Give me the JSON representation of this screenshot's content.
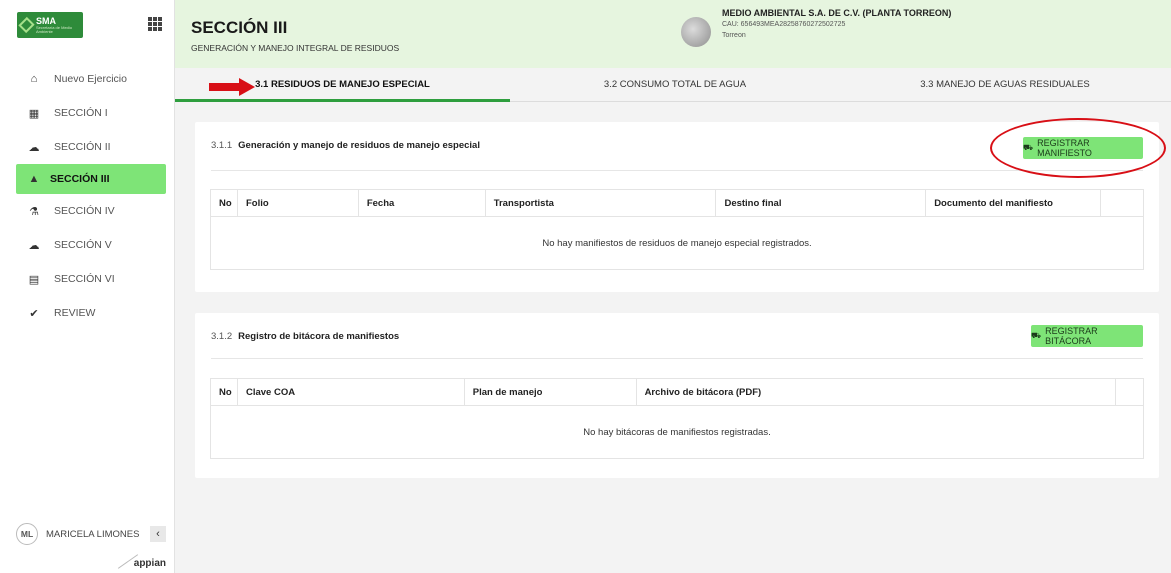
{
  "sidebar": {
    "logo_text": "SMA",
    "logo_subtext": "Secretaría de Medio Ambiente",
    "items": [
      {
        "label": "Nuevo Ejercicio",
        "icon": "home-icon",
        "glyph": "⌂"
      },
      {
        "label": "SECCIÓN I",
        "icon": "building-icon",
        "glyph": "▦"
      },
      {
        "label": "SECCIÓN II",
        "icon": "cloud-rain-icon",
        "glyph": "☁"
      },
      {
        "label": "SECCIÓN III",
        "icon": "warning-icon",
        "glyph": "▲",
        "active": true
      },
      {
        "label": "SECCIÓN IV",
        "icon": "flask-icon",
        "glyph": "⚗"
      },
      {
        "label": "SECCIÓN V",
        "icon": "cloud-icon",
        "glyph": "☁"
      },
      {
        "label": "SECCIÓN VI",
        "icon": "document-icon",
        "glyph": "▤"
      },
      {
        "label": "REVIEW",
        "icon": "check-circle-icon",
        "glyph": "✔"
      }
    ],
    "user": {
      "initials": "ML",
      "name": "MARICELA LIMONES",
      "collapse_glyph": "‹"
    },
    "brand": "appian"
  },
  "header": {
    "title": "SECCIÓN III",
    "subtitle": "GENERACIÓN Y MANEJO INTEGRAL DE RESIDUOS",
    "company": {
      "name": "MEDIO AMBIENTAL S.A. DE C.V. (PLANTA TORREON)",
      "cau": "CAU: 656493MEA28258760272502725",
      "city": "Torreon"
    }
  },
  "tabs": [
    {
      "label": "3.1 RESIDUOS DE MANEJO ESPECIAL",
      "active": true
    },
    {
      "label": "3.2 CONSUMO TOTAL DE AGUA"
    },
    {
      "label": "3.3 MANEJO DE AGUAS RESIDUALES"
    }
  ],
  "section1": {
    "number": "3.1.1",
    "title": "Generación y manejo de residuos de manejo especial",
    "button_label": "REGISTRAR MANIFIESTO",
    "columns": [
      "No",
      "Folio",
      "Fecha",
      "Transportista",
      "Destino final",
      "Documento del manifiesto",
      ""
    ],
    "empty_message": "No hay manifiestos de residuos de manejo especial registrados."
  },
  "section2": {
    "number": "3.1.2",
    "title": "Registro de bitácora de manifiestos",
    "button_label": "REGISTRAR BITÁCORA",
    "columns": [
      "No",
      "Clave COA",
      "Plan de manejo",
      "Archivo de bitácora (PDF)",
      ""
    ],
    "empty_message": "No hay bitácoras de manifiestos registradas."
  },
  "colors": {
    "accent_green": "#7ee477",
    "header_bg": "#e6f5df",
    "tab_underline": "#2e9e3e",
    "annotation_red": "#d80f16"
  }
}
